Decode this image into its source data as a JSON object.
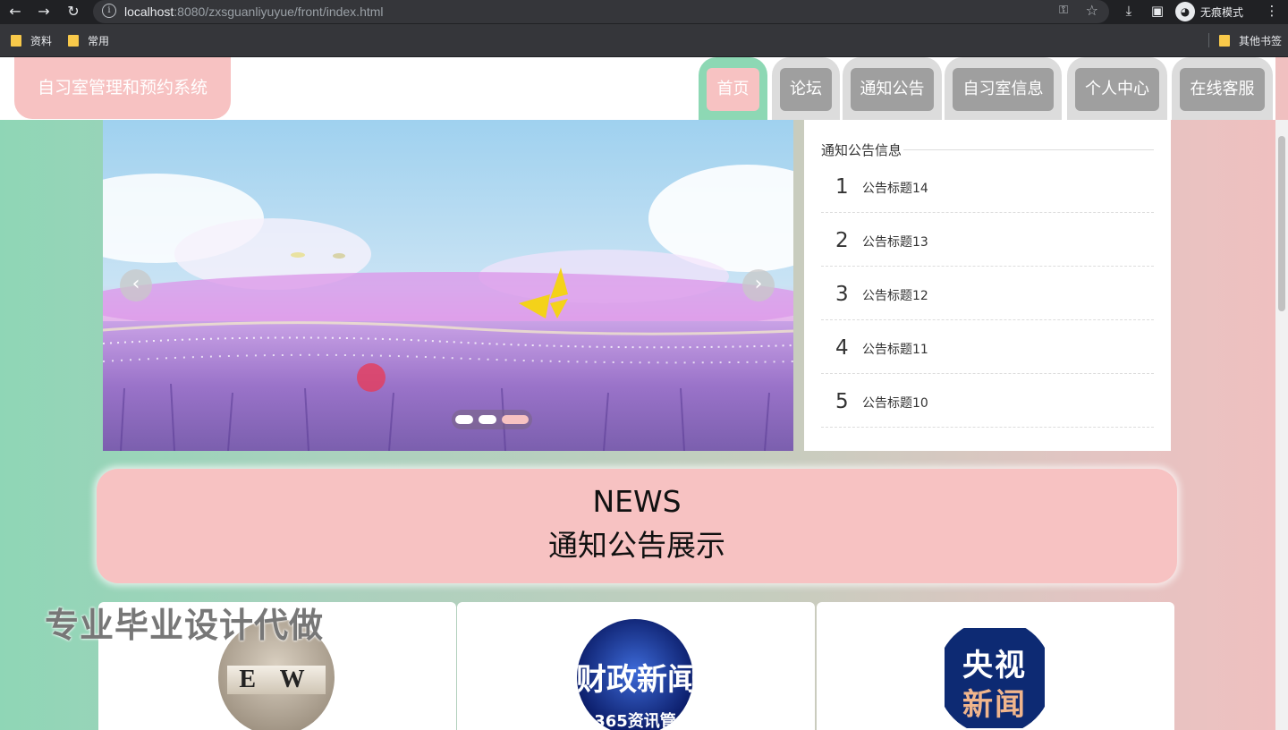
{
  "browser": {
    "url_host": "localhost",
    "url_path": ":8080/zxsguanliyuyue/front/index.html",
    "incognito_label": "无痕模式",
    "bookmarks": [
      "资料",
      "常用"
    ],
    "other_bookmarks": "其他书签"
  },
  "header": {
    "logo": "自习室管理和预约系统",
    "nav": [
      "首页",
      "论坛",
      "通知公告",
      "自习室信息",
      "个人中心",
      "在线客服"
    ],
    "active_index": 0
  },
  "carousel": {
    "prev_label": "‹",
    "next_label": "›",
    "dots_count": 3,
    "active_dot": 2
  },
  "notice": {
    "title": "通知公告信息",
    "items": [
      {
        "num": "1",
        "text": "公告标题14"
      },
      {
        "num": "2",
        "text": "公告标题13"
      },
      {
        "num": "3",
        "text": "公告标题12"
      },
      {
        "num": "4",
        "text": "公告标题11"
      },
      {
        "num": "5",
        "text": "公告标题10"
      }
    ]
  },
  "news": {
    "en": "NEWS",
    "zh": "通知公告展示"
  },
  "cards": [
    {
      "thumb_text": "E W"
    },
    {
      "thumb_text": "财政新闻",
      "thumb_sub": "365资讯管"
    },
    {
      "thumb_text_1": "央视",
      "thumb_text_2": "新闻"
    }
  ],
  "watermark": "专业毕业设计代做",
  "colors": {
    "accent_pink": "#f7c2c2",
    "accent_green": "#8dd8b4",
    "nav_gray": "#9f9f9f"
  }
}
